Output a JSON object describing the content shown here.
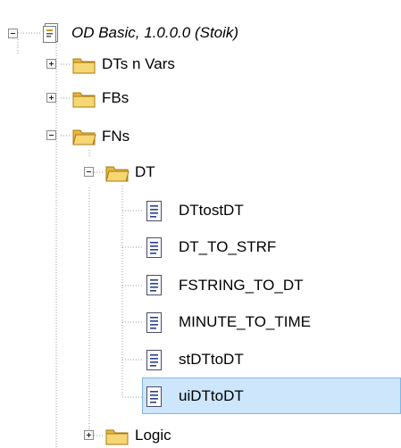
{
  "tree": {
    "root": {
      "label": "OD Basic, 1.0.0.0 (Stoik)",
      "expanded": true,
      "icon": "project-file-icon"
    },
    "folders": [
      {
        "label": "DTs n Vars",
        "expanded": false,
        "icon": "folder-icon"
      },
      {
        "label": "FBs",
        "expanded": false,
        "icon": "folder-icon"
      },
      {
        "label": "FNs",
        "expanded": true,
        "icon": "folder-icon"
      },
      {
        "label": "DT",
        "expanded": true,
        "icon": "folder-icon"
      },
      {
        "label": "Logic",
        "expanded": false,
        "icon": "folder-icon"
      }
    ],
    "items": [
      {
        "label": "DTtostDT",
        "icon": "document-icon"
      },
      {
        "label": "DT_TO_STRF",
        "icon": "document-icon"
      },
      {
        "label": "FSTRING_TO_DT",
        "icon": "document-icon"
      },
      {
        "label": "MINUTE_TO_TIME",
        "icon": "document-icon"
      },
      {
        "label": "stDTtoDT",
        "icon": "document-icon"
      },
      {
        "label": "uiDTtoDT",
        "icon": "document-icon",
        "selected": true
      }
    ]
  },
  "colors": {
    "selection_fill": "#cde6fb",
    "selection_border": "#7fb6e5",
    "folder_fill": "#f3cf5e",
    "document_lines": "#2a3f8f"
  }
}
